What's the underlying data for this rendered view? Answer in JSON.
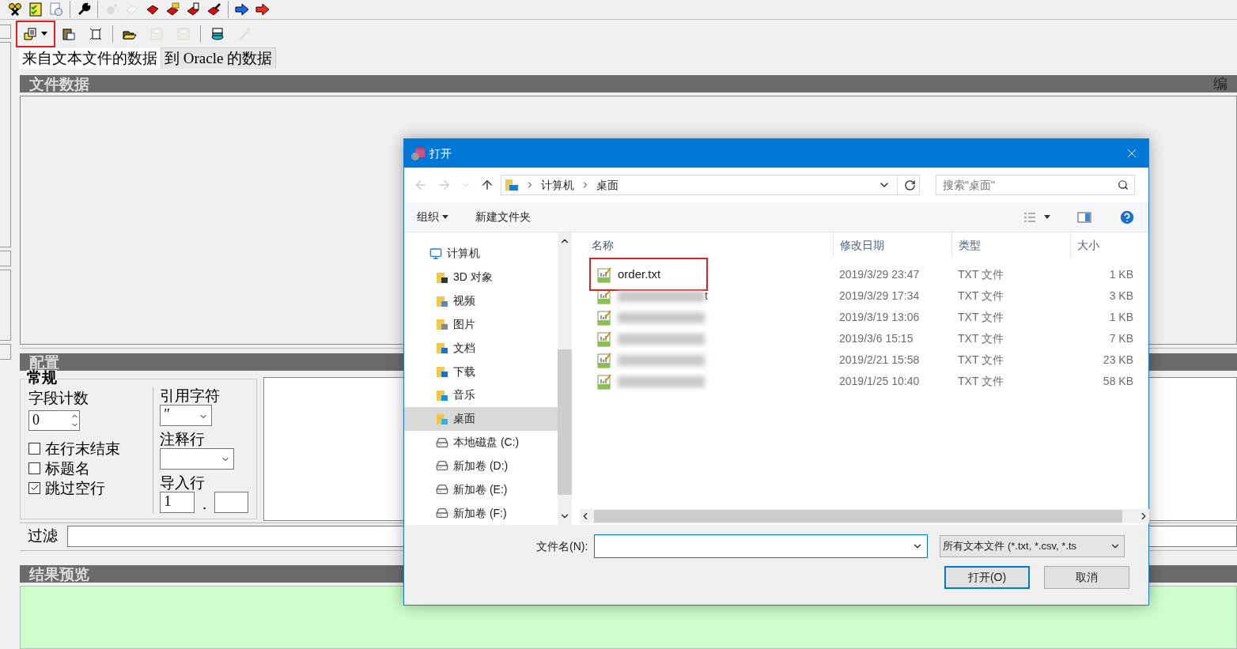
{
  "toolbar_1": [
    {
      "kind": "keys",
      "disabled": false
    },
    {
      "kind": "checklist",
      "disabled": false
    },
    {
      "kind": "report",
      "disabled": false
    },
    {
      "kind": "sep"
    },
    {
      "kind": "wrench",
      "disabled": false
    },
    {
      "kind": "sep"
    },
    {
      "kind": "gear",
      "disabled": true
    },
    {
      "kind": "book",
      "disabled": true
    },
    {
      "kind": "book-red",
      "disabled": false
    },
    {
      "kind": "book-folder",
      "disabled": false
    },
    {
      "kind": "book-copy",
      "disabled": false
    },
    {
      "kind": "book-edit",
      "disabled": false
    },
    {
      "kind": "sep"
    },
    {
      "kind": "arrow-blue",
      "disabled": false
    },
    {
      "kind": "arrow-red",
      "disabled": false
    }
  ],
  "toolbar_2": [
    {
      "kind": "open-file",
      "disabled": false,
      "highlighted": true
    },
    {
      "kind": "paste",
      "disabled": false,
      "highlighted": false
    },
    {
      "kind": "new",
      "disabled": false,
      "highlighted": false
    },
    {
      "kind": "sep"
    },
    {
      "kind": "open-folder",
      "disabled": false,
      "highlighted": false
    },
    {
      "kind": "save",
      "disabled": true,
      "highlighted": false
    },
    {
      "kind": "save-all",
      "disabled": true,
      "highlighted": false
    },
    {
      "kind": "sep"
    },
    {
      "kind": "database",
      "disabled": false,
      "highlighted": false
    },
    {
      "kind": "wand",
      "disabled": true,
      "highlighted": false
    }
  ],
  "tabs": [
    {
      "label": "来自文本文件的数据",
      "selected": true
    },
    {
      "label": "到 Oracle 的数据",
      "selected": false
    }
  ],
  "file_data": {
    "title": "文件数据",
    "right_label": "编"
  },
  "config": {
    "title": "配置",
    "group": "常规",
    "field_count": {
      "label": "字段计数",
      "value": "0"
    },
    "checkboxes": [
      {
        "label": "在行末结束",
        "checked": false
      },
      {
        "label": "标题名",
        "checked": false
      },
      {
        "label": "跳过空行",
        "checked": true
      }
    ],
    "quote_char": {
      "label": "引用字符",
      "value": "″"
    },
    "comment_line": {
      "label": "注释行"
    },
    "import_rows": {
      "label": "导入行",
      "from": "1",
      "separator": "."
    },
    "filter": {
      "label": "过滤"
    }
  },
  "preview": {
    "title": "结果预览"
  },
  "dialog": {
    "title": "打开",
    "path": [
      "计算机",
      "桌面"
    ],
    "search_placeholder": "搜索\"桌面\"",
    "commands": [
      "组织",
      "新建文件夹"
    ],
    "tree": [
      {
        "label": "计算机",
        "kind": "computer",
        "selected": false
      },
      {
        "label": "3D 对象",
        "kind": "folder",
        "selected": false
      },
      {
        "label": "视频",
        "kind": "folder",
        "selected": false
      },
      {
        "label": "图片",
        "kind": "folder",
        "selected": false
      },
      {
        "label": "文档",
        "kind": "folder",
        "selected": false
      },
      {
        "label": "下载",
        "kind": "folder",
        "selected": false
      },
      {
        "label": "音乐",
        "kind": "folder",
        "selected": false
      },
      {
        "label": "桌面",
        "kind": "folder",
        "selected": true
      },
      {
        "label": "本地磁盘 (C:)",
        "kind": "drive",
        "selected": false
      },
      {
        "label": "新加卷 (D:)",
        "kind": "drive",
        "selected": false
      },
      {
        "label": "新加卷 (E:)",
        "kind": "drive",
        "selected": false
      },
      {
        "label": "新加卷 (F:)",
        "kind": "drive",
        "selected": false
      }
    ],
    "columns": [
      "名称",
      "修改日期",
      "类型",
      "大小"
    ],
    "files": [
      {
        "name": "order.txt",
        "blurred": false,
        "highlighted": true,
        "date": "2019/3/29 23:47",
        "type": "TXT 文件",
        "size": "1 KB"
      },
      {
        "name": "t",
        "blurred": true,
        "highlighted": false,
        "date": "2019/3/29 17:34",
        "type": "TXT 文件",
        "size": "3 KB"
      },
      {
        "blurred": true,
        "highlighted": false,
        "date": "2019/3/19 13:06",
        "type": "TXT 文件",
        "size": "1 KB"
      },
      {
        "blurred": true,
        "highlighted": false,
        "date": "2019/3/6 15:15",
        "type": "TXT 文件",
        "size": "7 KB"
      },
      {
        "blurred": true,
        "highlighted": false,
        "date": "2019/2/21 15:58",
        "type": "TXT 文件",
        "size": "23 KB"
      },
      {
        "blurred": true,
        "highlighted": false,
        "date": "2019/1/25 10:40",
        "type": "TXT 文件",
        "size": "58 KB"
      }
    ],
    "filename_label": "文件名(N):",
    "file_type": "所有文本文件 (*.txt, *.csv, *.ts",
    "buttons": [
      {
        "label": "打开(O)",
        "default": true
      },
      {
        "label": "取消",
        "default": false
      }
    ]
  }
}
